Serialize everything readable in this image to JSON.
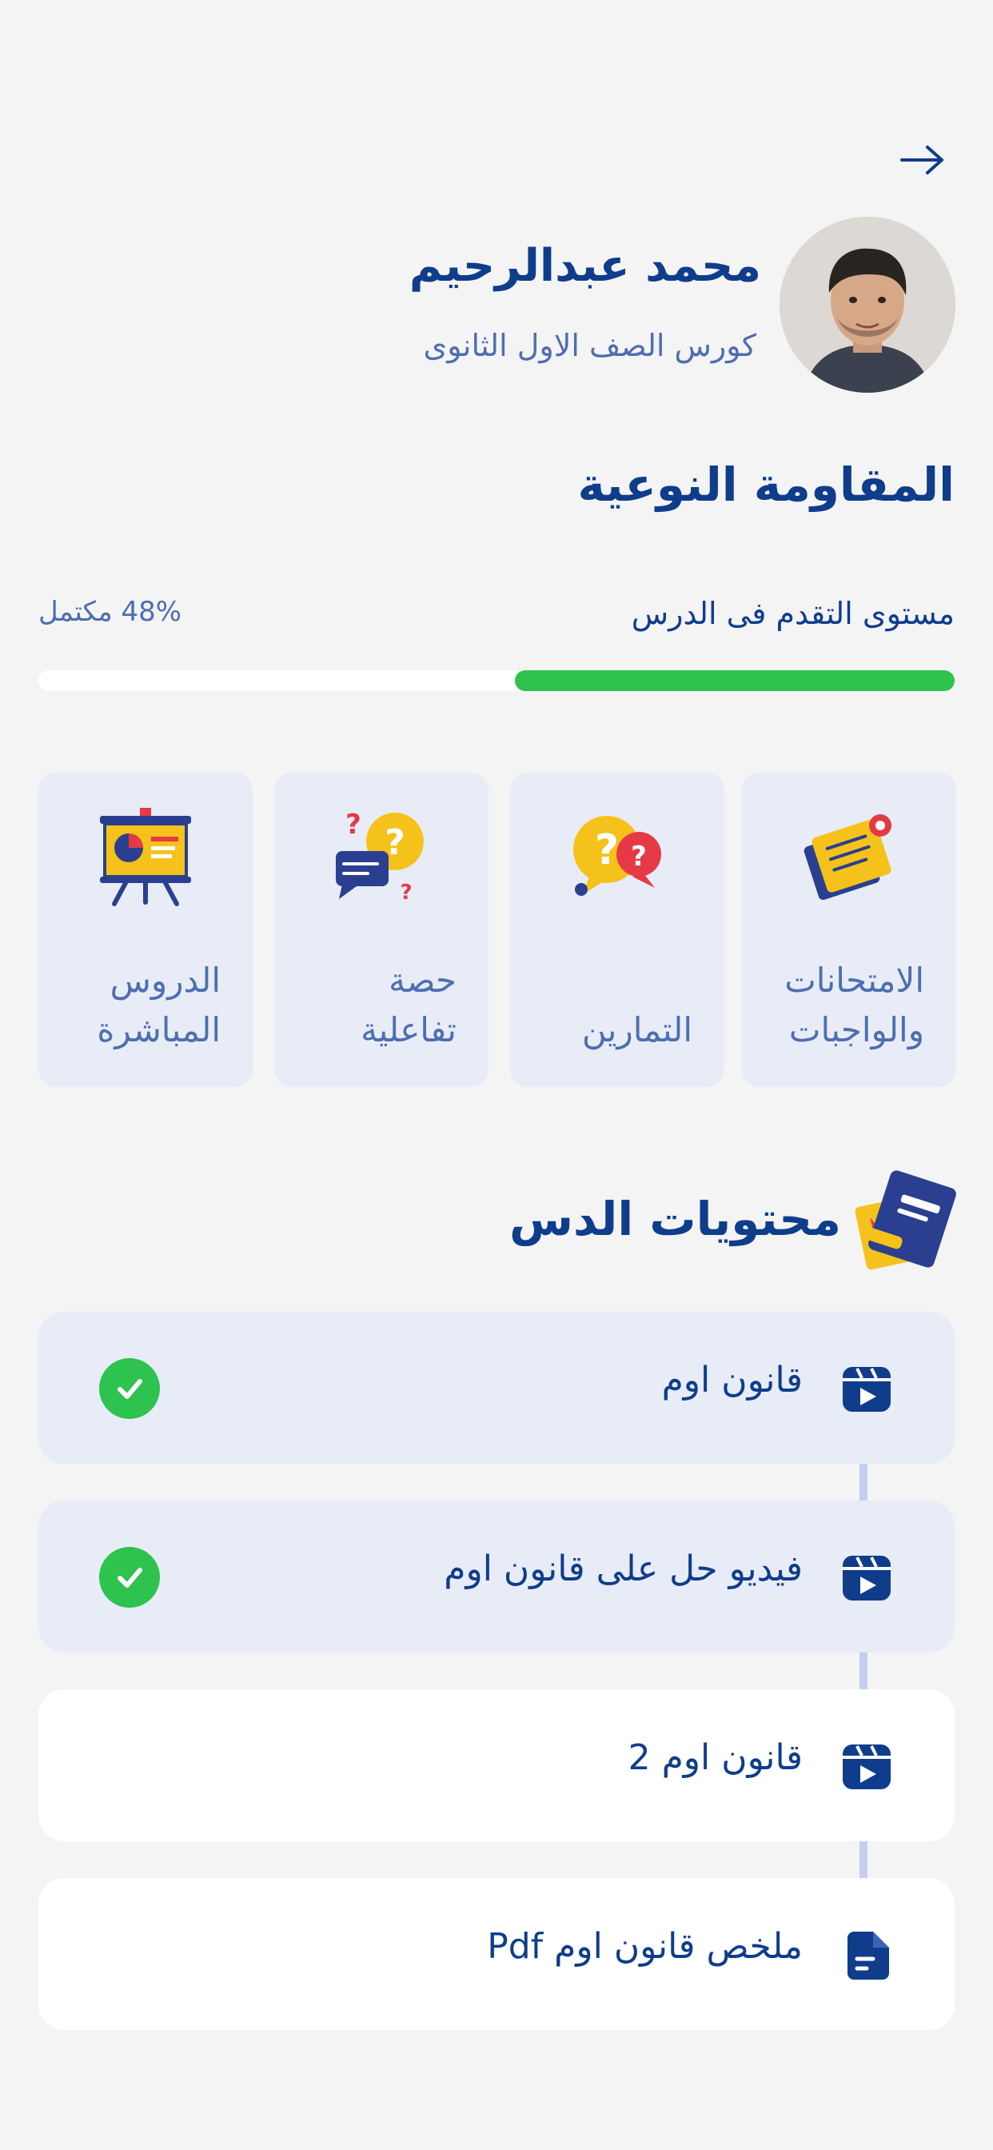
{
  "header": {
    "back_icon": "arrow-right-icon"
  },
  "profile": {
    "name": "محمد عبدالرحيم",
    "course": "كورس الصف الاول الثانوى",
    "avatar_icon": "person-avatar"
  },
  "lesson": {
    "title": "المقاومة النوعية"
  },
  "progress": {
    "label": "مستوى التقدم فى الدرس",
    "percent_text": "48% مكتمل",
    "value": 0.48,
    "fill_color": "#2ec24f",
    "track_color": "#ffffff"
  },
  "cards": [
    {
      "label": "الامتحانات\nوالواجبات",
      "icon": "exam-papers-icon"
    },
    {
      "label": "التمارين",
      "icon": "question-bubbles-icon"
    },
    {
      "label": "حصة\nتفاعلية",
      "icon": "interactive-chat-icon"
    },
    {
      "label": "الدروس\nالمباشرة",
      "icon": "presentation-board-icon"
    }
  ],
  "contents": {
    "title": "محتويات الدس",
    "icon": "book-icon",
    "items": [
      {
        "label": "قانون اوم",
        "type": "video",
        "icon": "video-icon",
        "completed": true
      },
      {
        "label": "فيديو حل على قانون اوم",
        "type": "video",
        "icon": "video-icon",
        "completed": true
      },
      {
        "label": "قانون اوم 2",
        "type": "video",
        "icon": "video-icon",
        "completed": false
      },
      {
        "label": "ملخص قانون اوم Pdf",
        "type": "pdf",
        "icon": "document-icon",
        "completed": false
      }
    ]
  },
  "colors": {
    "primary": "#0f3d8c",
    "secondary_text": "#4d6eb0",
    "card_bg": "#e7ecf7",
    "success": "#2ec24f",
    "background": "#f4f4f4"
  }
}
